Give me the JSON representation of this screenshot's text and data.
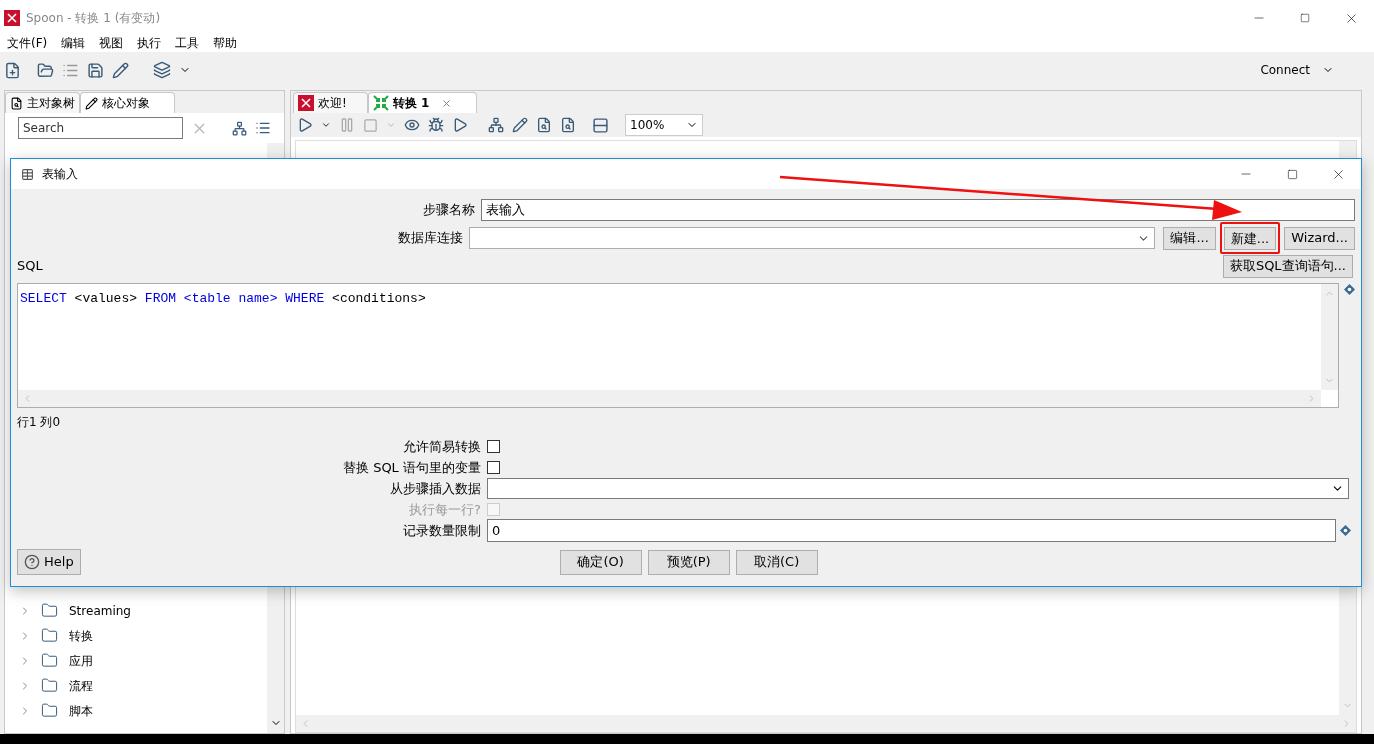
{
  "window": {
    "title": "Spoon - 转换 1 (有变动)"
  },
  "menu": [
    "文件(F)",
    "编辑",
    "视图",
    "执行",
    "工具",
    "帮助"
  ],
  "toolbar": {
    "connect": "Connect"
  },
  "left_panel": {
    "tabs": [
      {
        "label": "主对象树",
        "selected": false
      },
      {
        "label": "核心对象",
        "selected": true
      }
    ],
    "search": {
      "placeholder": "Search"
    },
    "tree": [
      {
        "label": "Streaming",
        "expanded": false
      },
      {
        "label": "转换",
        "expanded": false
      },
      {
        "label": "应用",
        "expanded": false
      },
      {
        "label": "流程",
        "expanded": false
      },
      {
        "label": "脚本",
        "expanded": false
      }
    ]
  },
  "editor_tabs": [
    {
      "label": "欢迎!",
      "selected": false,
      "kind": "welcome"
    },
    {
      "label": "转换 1",
      "selected": true,
      "kind": "transform"
    }
  ],
  "zoom": "100%",
  "dialog": {
    "title": "表输入",
    "step_name": {
      "label": "步骤名称",
      "value": "表输入"
    },
    "connection": {
      "label": "数据库连接",
      "buttons": [
        {
          "label": "编辑...",
          "highlighted": false
        },
        {
          "label": "新建...",
          "highlighted": true
        },
        {
          "label": "Wizard...",
          "highlighted": false
        }
      ]
    },
    "sql_label": "SQL",
    "get_sql_button": "获取SQL查询语句...",
    "sql": [
      {
        "text": "SELECT",
        "kind": "keyword"
      },
      {
        "text": "<values>",
        "kind": "plain"
      },
      {
        "text": "FROM",
        "kind": "keyword"
      },
      {
        "text": "<table name>",
        "kind": "keyword"
      },
      {
        "text": "WHERE",
        "kind": "keyword"
      },
      {
        "text": "<conditions>",
        "kind": "plain"
      }
    ],
    "position": "行1 列0",
    "options": [
      {
        "kind": "checkbox",
        "label": "允许简易转换",
        "checked": false,
        "disabled": false
      },
      {
        "kind": "checkbox",
        "label": "替换 SQL 语句里的变量",
        "checked": false,
        "disabled": false
      },
      {
        "kind": "combo",
        "label": "从步骤插入数据"
      },
      {
        "kind": "checkbox",
        "label": "执行每一行?",
        "checked": false,
        "disabled": true
      },
      {
        "kind": "text",
        "label": "记录数量限制",
        "value": "0"
      }
    ],
    "help": "Help",
    "buttons": [
      "确定(O)",
      "预览(P)",
      "取消(C)"
    ]
  }
}
